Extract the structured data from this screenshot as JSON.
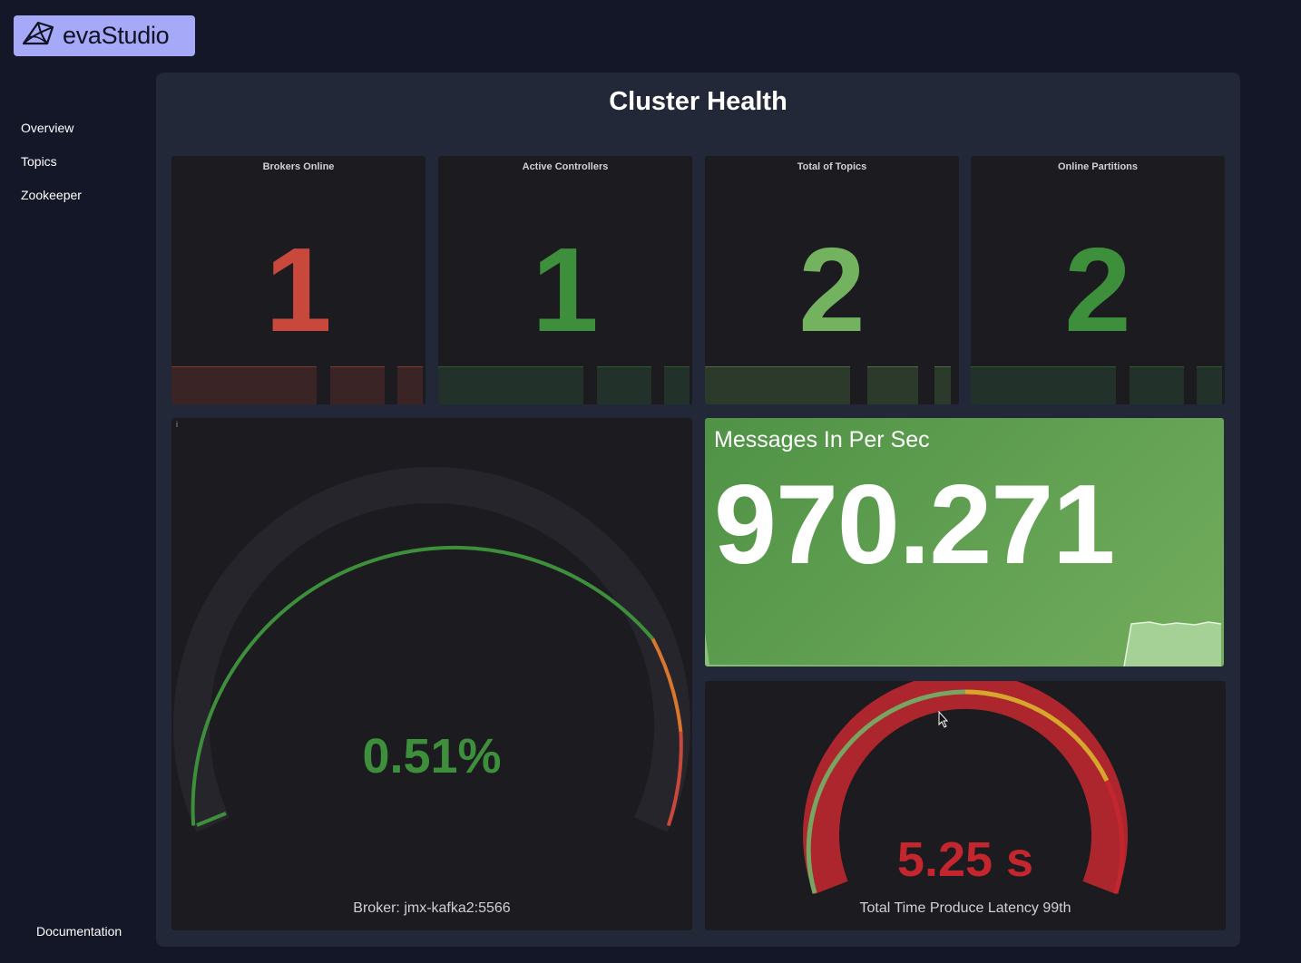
{
  "app": {
    "logo_text": "evaStudio",
    "logo_icon": "sailboat-logo-icon"
  },
  "sidebar": {
    "items": [
      {
        "label": "Overview"
      },
      {
        "label": "Topics"
      },
      {
        "label": "Zookeeper"
      }
    ],
    "documentation_label": "Documentation"
  },
  "dashboard": {
    "title": "Cluster Health",
    "stats": [
      {
        "title": "Brokers Online",
        "value": "1",
        "color": "#c8493b"
      },
      {
        "title": "Active Controllers",
        "value": "1",
        "color": "#3e8f3b"
      },
      {
        "title": "Total of Topics",
        "value": "2",
        "color": "#73b25f"
      },
      {
        "title": "Online Partitions",
        "value": "2",
        "color": "#3e8f3b"
      }
    ],
    "broker_gauge": {
      "value_text": "0.51%",
      "value": 0.51,
      "caption": "Broker: jmx-kafka2:5566",
      "value_color": "#3e8f3b",
      "info_glyph": "i"
    },
    "messages_in": {
      "title": "Messages In Per Sec",
      "value": "970.271",
      "background": "#5d9d4f"
    },
    "latency_gauge": {
      "value_text": "5.25 s",
      "caption": "Total Time Produce Latency 99th",
      "value_color": "#c4262e"
    }
  },
  "colors": {
    "background": "#141727",
    "panel": "#222838",
    "card": "#1b1b20",
    "logo_bg": "#a5a9f7",
    "green": "#3e8f3b",
    "red": "#c8493b"
  }
}
